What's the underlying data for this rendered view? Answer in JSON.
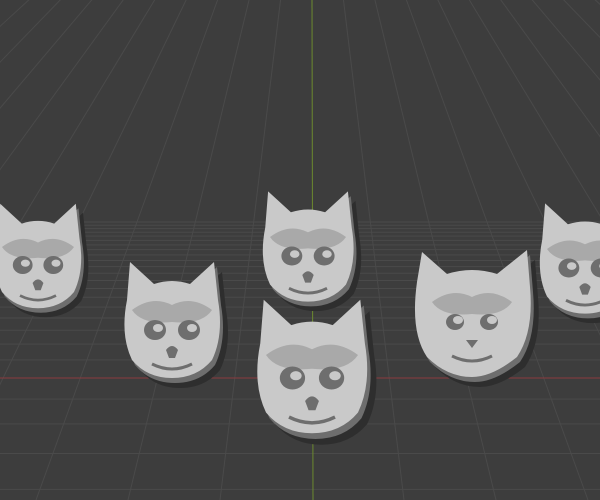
{
  "viewport": {
    "background": "#3d3d3d",
    "grid_color": "#4a4a4a",
    "x_axis_color": "#8a3a3e",
    "y_axis_color": "#6c8a2e"
  },
  "objects": [
    {
      "name": "cat-skull-left-edge",
      "type": "skull"
    },
    {
      "name": "cat-skull-front-left",
      "type": "skull"
    },
    {
      "name": "cat-skull-back-center",
      "type": "skull"
    },
    {
      "name": "cat-skull-front-center",
      "type": "skull"
    },
    {
      "name": "cat-head-right",
      "type": "cat"
    },
    {
      "name": "cat-skull-right-edge",
      "type": "skull"
    }
  ],
  "model_colors": {
    "light": "#c9c9c9",
    "mid": "#a9a9a9",
    "dark": "#6e6e6e",
    "shadow": "#2e2e2e"
  }
}
